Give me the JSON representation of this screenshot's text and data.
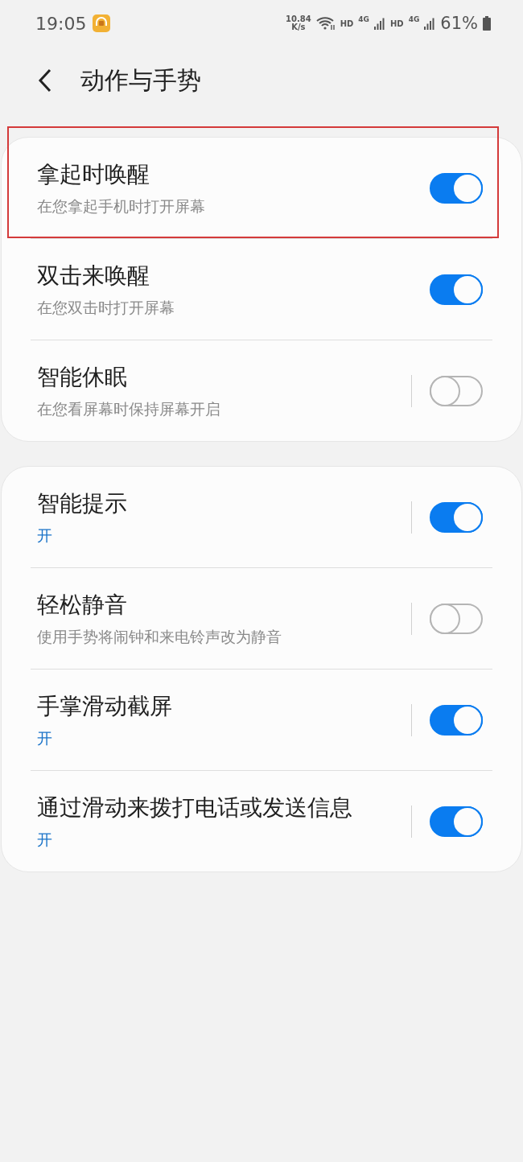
{
  "status_bar": {
    "time": "19:05",
    "speed_value": "10.84",
    "speed_unit": "K/s",
    "sims": [
      {
        "hd": "HD",
        "network": "4G"
      },
      {
        "hd": "HD",
        "network": "4G"
      }
    ],
    "battery": "61%"
  },
  "header": {
    "title": "动作与手势"
  },
  "groups": [
    {
      "items": [
        {
          "title": "拿起时唤醒",
          "subtitle": "在您拿起手机时打开屏幕",
          "kind": "desc",
          "on": true,
          "separated": false,
          "highlighted": true
        },
        {
          "title": "双击来唤醒",
          "subtitle": "在您双击时打开屏幕",
          "kind": "desc",
          "on": true,
          "separated": false,
          "highlighted": false
        },
        {
          "title": "智能休眠",
          "subtitle": "在您看屏幕时保持屏幕开启",
          "kind": "desc",
          "on": false,
          "separated": true,
          "highlighted": false
        }
      ]
    },
    {
      "items": [
        {
          "title": "智能提示",
          "subtitle": "开",
          "kind": "status",
          "on": true,
          "separated": true,
          "highlighted": false
        },
        {
          "title": "轻松静音",
          "subtitle": "使用手势将闹钟和来电铃声改为静音",
          "kind": "desc",
          "on": false,
          "separated": true,
          "highlighted": false
        },
        {
          "title": "手掌滑动截屏",
          "subtitle": "开",
          "kind": "status",
          "on": true,
          "separated": true,
          "highlighted": false
        },
        {
          "title": "通过滑动来拨打电话或发送信息",
          "subtitle": "开",
          "kind": "status",
          "on": true,
          "separated": true,
          "highlighted": false
        }
      ]
    }
  ]
}
